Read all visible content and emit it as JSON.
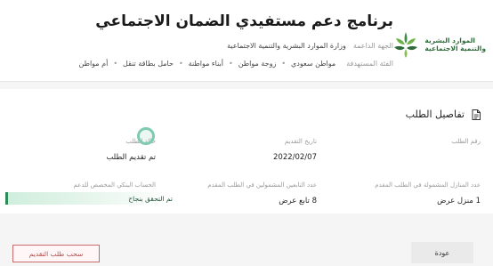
{
  "header": {
    "logo_line1": "الموارد البشرية",
    "logo_line2": "والتنمية الاجتماعية",
    "program_title": "برنامج دعم مستفيدي الضمان الاجتماعي",
    "entity_label": "الجهة الداعمة",
    "entity_value": "وزارة الموارد البشرية والتنمية الاجتماعية",
    "category_label": "الفئة المستهدفة",
    "categories": [
      "مواطن سعودي",
      "زوجة مواطن",
      "أبناء مواطنة",
      "حامل بطاقة تنقل",
      "أم مواطن"
    ]
  },
  "details": {
    "section_title": "تفاصيل الطلب",
    "request_number_label": "رقم الطلب",
    "request_number_value": "",
    "request_date_label": "تاريخ التقديم",
    "request_date_value": "2022/02/07",
    "status_label": "حالة الطلب",
    "status_value": "تم تقديم الطلب",
    "housing_label": "عدد المنازل المشمولة في الطلب المقدم",
    "housing_value": "1 منزل عرض",
    "dependents_label": "عدد التابعين المشمولين في الطلب المقدم",
    "dependents_value": "8 تابع عرض",
    "account_label": "الحساب البنكي المخصص للدعم",
    "account_value": "تم التحقق بنجاح"
  },
  "footer": {
    "withdraw_label": "سحب طلب التقديم",
    "back_label": "عودة"
  },
  "colors": {
    "brand_green": "#2f6b3a",
    "verified_green": "#2e8b57",
    "withdraw_red": "#b04a4a"
  }
}
